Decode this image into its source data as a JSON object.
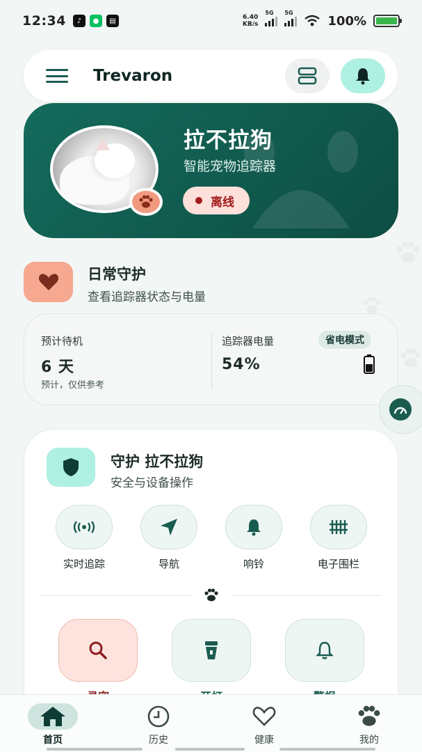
{
  "status_bar": {
    "time": "12:34",
    "app_icons": [
      "tiktok-icon",
      "wechat-icon",
      "news-app-icon"
    ],
    "net_speed_value": "6.40",
    "net_speed_unit": "KB/s",
    "signal1_label": "5G",
    "signal2_label": "5G",
    "battery_percent": "100%"
  },
  "header": {
    "app_name": "Trevaron",
    "icons": [
      "menu-icon",
      "device-list-icon",
      "bell-icon"
    ]
  },
  "pet": {
    "name": "拉不拉狗",
    "device_type": "智能宠物追踪器",
    "status": "离线",
    "status_color": "#a31b1b"
  },
  "daily_guard": {
    "title": "日常守护",
    "subtitle": "查看追踪器状态与电量",
    "icon": "heart-icon"
  },
  "stats": {
    "standby_label": "预计待机",
    "standby_value": "6 天",
    "standby_note": "预计，仅供参考",
    "battery_label": "追踪器电量",
    "battery_value": "54%",
    "battery_level": 0.54,
    "mode": "省电模式"
  },
  "guard_card": {
    "title": "守护 拉不拉狗",
    "subtitle": "安全与设备操作",
    "icon": "shield-icon",
    "actions": [
      {
        "label": "实时追踪",
        "icon": "live-tracking-icon"
      },
      {
        "label": "导航",
        "icon": "navigation-icon"
      },
      {
        "label": "响铃",
        "icon": "bell-icon"
      },
      {
        "label": "电子围栏",
        "icon": "fence-icon"
      }
    ],
    "big_actions": [
      {
        "label": "寻宠",
        "icon": "search-icon",
        "accent": "#8a1f1f"
      },
      {
        "label": "开灯",
        "icon": "flashlight-icon",
        "accent": "#1a5c50"
      },
      {
        "label": "警报",
        "icon": "alarm-bell-icon",
        "accent": "#1a5c50"
      }
    ]
  },
  "bottom_nav": [
    {
      "label": "首页",
      "icon": "home-icon",
      "active": true
    },
    {
      "label": "历史",
      "icon": "clock-icon",
      "active": false
    },
    {
      "label": "健康",
      "icon": "heart-outline-icon",
      "active": false
    },
    {
      "label": "我的",
      "icon": "paw-icon",
      "active": false
    }
  ],
  "colors": {
    "primary": "#1a5c50",
    "hero_bg": "#0e4d43",
    "mint": "#aef0e2",
    "coral": "#f6a890"
  }
}
